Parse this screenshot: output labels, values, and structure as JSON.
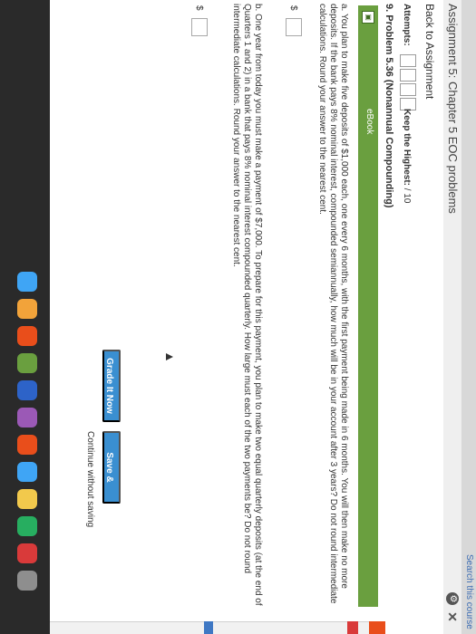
{
  "header": {
    "search_text": "Search this course",
    "assignment_title": "Assignment 5: Chapter 5 EOC problems",
    "settings_icon": "gear-icon",
    "close_icon": "close-icon"
  },
  "nav": {
    "back_label": "Back to Assignment"
  },
  "attempts": {
    "label": "Attempts:",
    "keep_label": "Keep the Highest:",
    "keep_value": "/ 10"
  },
  "problem": {
    "title": "9. Problem 5.36 (Nonannual Compounding)"
  },
  "ebook": {
    "label": "eBook",
    "icon": "ebook-icon"
  },
  "questions": [
    {
      "text": "a. You plan to make five deposits of $1,000 each, one every 6 months, with the first payment being made in 6 months. You will then make no more deposits. If the bank pays 8% nominal interest, compounded semiannually, how much will be in your account after 3 years? Do not round intermediate calculations. Round your answer to the nearest cent.",
      "currency": "$",
      "value": ""
    },
    {
      "text": "b. One year from today you must make a payment of $7,000. To prepare for this payment, you plan to make two equal quarterly deposits (at the end of Quarters 1 and 2) in a bank that pays 8% nominal interest compounded quarterly. How large must each of the two payments be? Do not round intermediate calculations. Round your answer to the nearest cent.",
      "currency": "$",
      "value": ""
    }
  ],
  "actions": {
    "grade_label": "Grade It Now",
    "save_label": "Save & Continue",
    "continue_label": "Continue without saving"
  },
  "colors": {
    "accent": "#3a8fd1",
    "ebook_green": "#6a9f3f"
  }
}
